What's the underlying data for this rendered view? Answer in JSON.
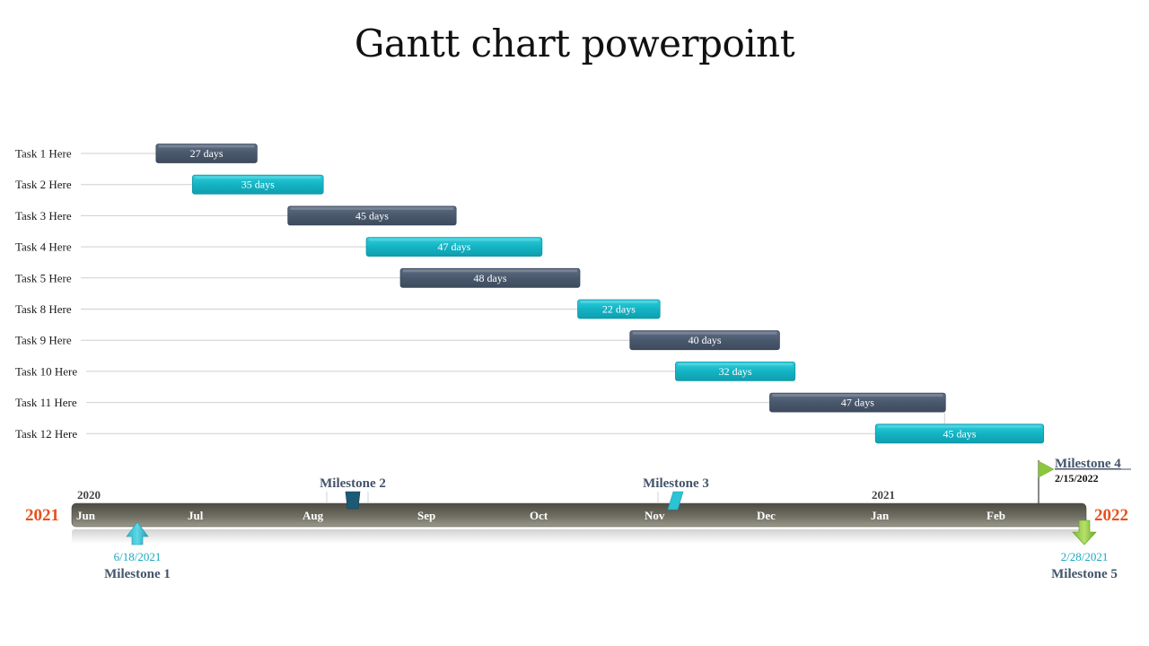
{
  "title": "Gantt chart powerpoint",
  "colors": {
    "dark_bar": "#475569",
    "teal_bar": "#14b3c4",
    "timeline_bar": "#6b6a5e",
    "year_accent": "#e8501c",
    "milestone_text": "#44546a",
    "date_teal": "#1aa8bc",
    "flag_green": "#8cc63f"
  },
  "chart_data": {
    "type": "gantt",
    "title": "Gantt chart powerpoint",
    "x_axis": {
      "range": [
        "2021-06-01",
        "2022-02-28"
      ],
      "months": [
        "Jun",
        "Jul",
        "Aug",
        "Sep",
        "Oct",
        "Nov",
        "Dec",
        "Jan",
        "Feb"
      ],
      "year_labels_top": [
        {
          "text": "2020",
          "month": "Jun"
        },
        {
          "text": "2021",
          "month": "Jan"
        }
      ],
      "start_year_label": "2021",
      "end_year_label": "2022"
    },
    "tasks": [
      {
        "name": "Task 1 Here",
        "start_month_offset": 0.71,
        "duration_label": "27 days",
        "days": 27,
        "color": "dark"
      },
      {
        "name": "Task 2 Here",
        "start_month_offset": 1.03,
        "duration_label": "35 days",
        "days": 35,
        "color": "teal"
      },
      {
        "name": "Task 3 Here",
        "start_month_offset": 1.87,
        "duration_label": "45 days",
        "days": 45,
        "color": "dark"
      },
      {
        "name": "Task 4 Here",
        "start_month_offset": 2.56,
        "duration_label": "47 days",
        "days": 47,
        "color": "teal"
      },
      {
        "name": "Task 5 Here",
        "start_month_offset": 2.86,
        "duration_label": "48 days",
        "days": 48,
        "color": "dark"
      },
      {
        "name": "Task 8 Here",
        "start_month_offset": 4.42,
        "duration_label": "22 days",
        "days": 22,
        "color": "teal"
      },
      {
        "name": "Task 9 Here",
        "start_month_offset": 4.88,
        "duration_label": "40 days",
        "days": 40,
        "color": "dark"
      },
      {
        "name": "Task 10 Here",
        "start_month_offset": 5.28,
        "duration_label": "32 days",
        "days": 32,
        "color": "teal"
      },
      {
        "name": "Task 11 Here",
        "start_month_offset": 6.11,
        "duration_label": "47 days",
        "days": 47,
        "color": "dark"
      },
      {
        "name": "Task 12 Here",
        "start_month_offset": 7.04,
        "duration_label": "45 days",
        "days": 45,
        "color": "teal"
      }
    ],
    "milestones": [
      {
        "name": "Milestone 1",
        "date_label": "6/18/2021",
        "month_offset": 0.57,
        "marker": "up-arrow",
        "position": "below"
      },
      {
        "name": "Milestone 2",
        "date_label": "",
        "month_offset": 2.35,
        "marker": "trapezoid",
        "position": "above"
      },
      {
        "name": "Milestone 3",
        "date_label": "",
        "month_offset": 5.17,
        "marker": "parallelogram",
        "position": "above"
      },
      {
        "name": "Milestone 4",
        "date_label": "2/15/2022",
        "month_offset": 8.55,
        "marker": "flag",
        "position": "above"
      },
      {
        "name": "Milestone 5",
        "date_label": "2/28/2021",
        "month_offset": 9.0,
        "marker": "down-arrow",
        "position": "below"
      }
    ]
  }
}
